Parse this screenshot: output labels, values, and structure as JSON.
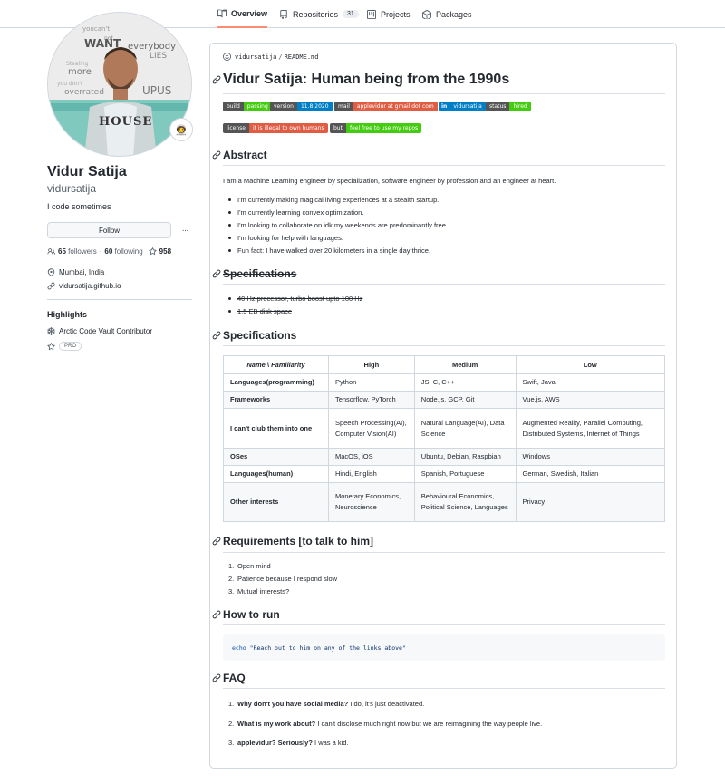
{
  "tabs": [
    {
      "label": "Overview",
      "icon": "book-icon",
      "active": true
    },
    {
      "label": "Repositories",
      "icon": "repo-icon",
      "count": "31"
    },
    {
      "label": "Projects",
      "icon": "project-icon"
    },
    {
      "label": "Packages",
      "icon": "package-icon"
    }
  ],
  "avatar": {
    "word_art": [
      "youcan't",
      "not",
      "WANT",
      "everybody",
      "LIES",
      "more",
      "UPUS",
      "HOUSE"
    ]
  },
  "profile": {
    "status_emoji": "🧑‍🚀",
    "name": "Vidur Satija",
    "login": "vidursatija",
    "bio": "I code sometimes",
    "follow_label": "Follow",
    "more_label": "···",
    "followers_count": "65",
    "followers_label": "followers",
    "following_count": "60",
    "following_label": "following",
    "stars_count": "958",
    "location": "Mumbai, India",
    "website": "vidursatija.github.io"
  },
  "highlights": {
    "title": "Highlights",
    "items": [
      {
        "label": "Arctic Code Vault Contributor",
        "icon": "arctic-vault-icon"
      },
      {
        "label": "PRO",
        "icon": "star-icon"
      }
    ]
  },
  "readme": {
    "path_user": "vidursatija",
    "path_sep": "/",
    "path_file": "README.md",
    "title": "Vidur Satija: Human being from the 1990s",
    "badges_row1": [
      {
        "left": "build",
        "right": "passing",
        "color": "green"
      },
      {
        "left": "version",
        "right": "11.8.2020",
        "color": "blue"
      },
      {
        "left": "mail",
        "right": "applevidur at gmail dot com",
        "color": "red"
      },
      {
        "left": "in",
        "right": "vidursatija",
        "color": "blue"
      },
      {
        "left": "status",
        "right": "hired",
        "color": "green"
      }
    ],
    "badges_row2": [
      {
        "left": "license",
        "right": "it is illegal to own humans",
        "color": "red"
      },
      {
        "left": "but",
        "right": "feel free to use my repos",
        "color": "green"
      }
    ],
    "abstract_heading": "Abstract",
    "abstract_text": "I am a Machine Learning engineer by specialization, software engineer by profession and an engineer at heart.",
    "abstract_list": [
      "I'm currently making magical living experiences at a stealth startup.",
      "I'm currently learning convex optimization.",
      "I'm looking to collaborate on idk my weekends are predominantly free.",
      "I'm looking for help with languages.",
      "Fun fact: I have walked over 20 kilometers in a single day thrice."
    ],
    "spec_struck_heading": "Specifications",
    "spec_struck_list": [
      "40 Hz processor, turbo boost upto 100 Hz",
      "1.5 EB disk space"
    ],
    "spec_heading": "Specifications",
    "table": {
      "head_name": "Name",
      "head_sep": " \\ ",
      "head_fam": "Familiarity",
      "headers": [
        "High",
        "Medium",
        "Low"
      ],
      "rows": [
        {
          "name": "Languages(programming)",
          "high": "Python",
          "medium": "JS, C, C++",
          "low": "Swift, Java"
        },
        {
          "name": "Frameworks",
          "high": "Tensorflow, PyTorch",
          "medium": "Node.js, GCP, Git",
          "low": "Vue.js, AWS"
        },
        {
          "name": "I can't club them into one",
          "high": "Speech Processing(AI), Computer Vision(AI)",
          "medium": "Natural Language(AI), Data Science",
          "low": "Augmented Reality, Parallel Computing, Distributed Systems, Internet of Things"
        },
        {
          "name": "OSes",
          "high": "MacOS, iOS",
          "medium": "Ubuntu, Debian, Raspbian",
          "low": "Windows"
        },
        {
          "name": "Languages(human)",
          "high": "Hindi, English",
          "medium": "Spanish, Portuguese",
          "low": "German, Swedish, Italian"
        },
        {
          "name": "Other interests",
          "high": "Monetary Economics, Neuroscience",
          "medium": "Behavioural Economics, Political Science, Languages",
          "low": "Privacy"
        }
      ]
    },
    "req_heading": "Requirements [to talk to him]",
    "req_list": [
      "Open mind",
      "Patience because I respond slow",
      "Mutual interests?"
    ],
    "run_heading": "How to run",
    "code_cmd": "echo",
    "code_str": "\"Reach out to him on any of the links above\"",
    "faq_heading": "FAQ",
    "faq": [
      {
        "q": "Why don't you have social media?",
        "a": "I do, it's just deactivated."
      },
      {
        "q": "What is my work about?",
        "a": "I can't disclose much right now but we are reimagining the way people live."
      },
      {
        "q": "applevidur? Seriously?",
        "a": "I was a kid."
      }
    ]
  }
}
